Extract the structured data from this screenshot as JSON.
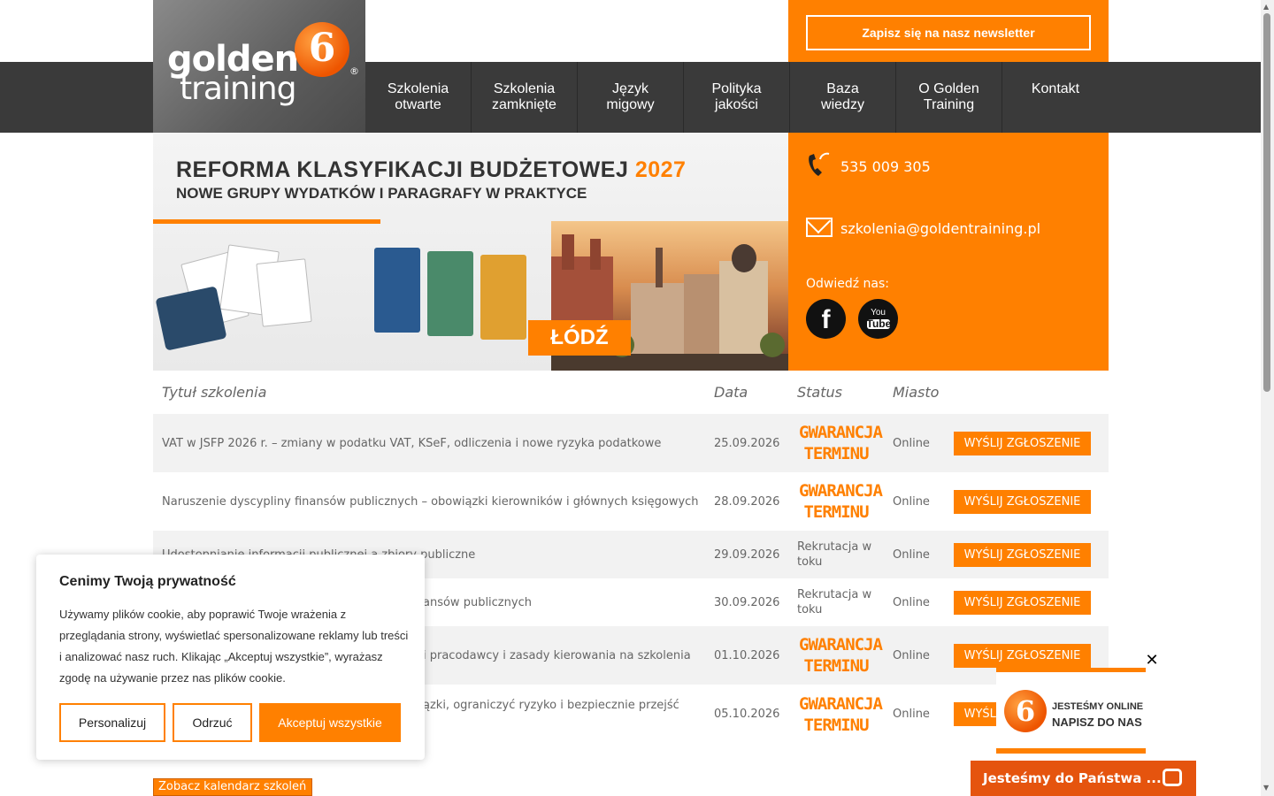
{
  "header": {
    "logo_line1": "golden",
    "logo_line2": "training",
    "logo_badge": "6",
    "logo_reg": "®",
    "newsletter_label": "Zapisz się na nasz newsletter"
  },
  "nav": {
    "items": [
      {
        "line1": "Szkolenia",
        "line2": "otwarte"
      },
      {
        "line1": "Szkolenia",
        "line2": "zamknięte"
      },
      {
        "line1": "Język",
        "line2": "migowy"
      },
      {
        "line1": "Polityka",
        "line2": "jakości"
      },
      {
        "line1": "Baza",
        "line2": "wiedzy"
      },
      {
        "line1": "O Golden",
        "line2": "Training"
      },
      {
        "line1": "Kontakt",
        "line2": ""
      }
    ]
  },
  "banner": {
    "title": "REFORMA KLASYFIKACJI BUDŻETOWEJ",
    "year": "2027",
    "subtitle": "NOWE GRUPY WYDATKÓW I PARAGRAFY W PRAKTYCE",
    "city": "ŁÓDŹ"
  },
  "contact": {
    "phone": "535 009 305",
    "email": "szkolenia@goldentraining.pl",
    "visit_label": "Odwiedź nas:",
    "facebook_glyph": "f",
    "youtube_you": "You",
    "youtube_tube": "Tube"
  },
  "table": {
    "headers": {
      "title": "Tytuł szkolenia",
      "date": "Data",
      "status": "Status",
      "city": "Miasto"
    },
    "rows": [
      {
        "title": "VAT w JSFP 2026 r. – zmiany w podatku VAT, KSeF, odliczenia i nowe ryzyka podatkowe",
        "date": "25.09.2026",
        "status": "",
        "city": "Online",
        "action": "WYŚLIJ ZGŁOSZENIE"
      },
      {
        "title": "Naruszenie dyscypliny finansów publicznych – obowiązki kierowników i głównych księgowych",
        "date": "28.09.2026",
        "status": "",
        "city": "Online",
        "action": "WYŚLIJ ZGŁOSZENIE"
      },
      {
        "title": "Udostępnianie informacji publicznej a zbiory publiczne",
        "date": "29.09.2026",
        "status": "Rekrutacja w toku",
        "city": "Online",
        "action": "WYŚLIJ ZGŁOSZENIE"
      },
      {
        "title": "ansów publicznych",
        "date": "30.09.2026",
        "status": "Rekrutacja w toku",
        "city": "Online",
        "action": "WYŚLIJ ZGŁOSZENIE"
      },
      {
        "title": "i pracodawcy i zasady kierowania na szkolenia",
        "date": "01.10.2026",
        "status": "",
        "city": "Online",
        "action": "WYŚLIJ ZGŁOSZENIE"
      },
      {
        "title": "ązki, ograniczyć ryzyko i bezpiecznie przejść",
        "date": "05.10.2026",
        "status": "",
        "city": "Online",
        "action": "WYŚLIJ ZGŁOSZENIE"
      }
    ],
    "guarantee_line1": "GWARANCJA",
    "guarantee_line2": "TERMINU"
  },
  "calendar_btn": "Zobacz kalendarz szkoleń",
  "cookie": {
    "title": "Cenimy Twoją prywatność",
    "text": "Używamy plików cookie, aby poprawić Twoje wrażenia z przeglądania strony, wyświetlać spersonalizowane reklamy lub treści i analizować nasz ruch. Klikając „Akceptuj wszystkie”, wyrażasz zgodę na używanie przez nas plików cookie.",
    "btn_personalize": "Personalizuj",
    "btn_reject": "Odrzuć",
    "btn_accept": "Akceptuj wszystkie"
  },
  "chat": {
    "line1": "JESTEŚMY ONLINE",
    "line2": "NAPISZ DO NAS",
    "close": "✕",
    "bar_label": "Jesteśmy do Państwa ..."
  },
  "colors": {
    "accent": "#ff8000",
    "nav_bg": "#3a3a3a"
  }
}
